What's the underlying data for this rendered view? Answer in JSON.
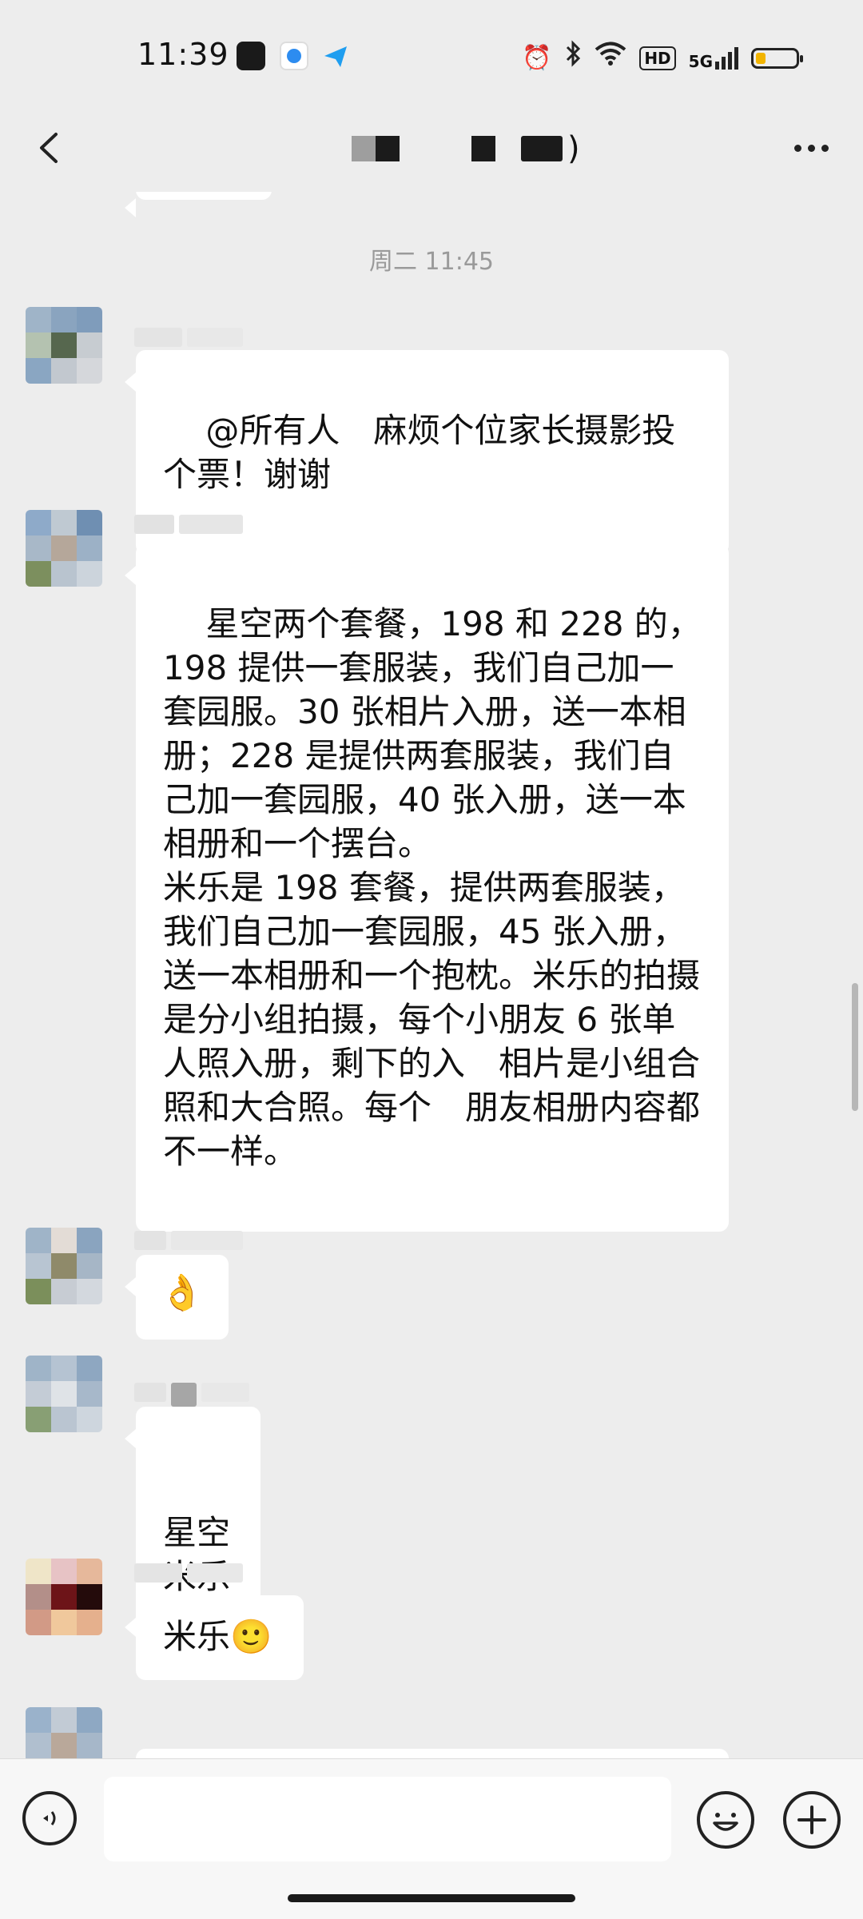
{
  "status_bar": {
    "time": "11:39",
    "network": "5G",
    "hd_label": "HD",
    "battery_percent": 25,
    "battery_color": "#f2b400",
    "icons": [
      "alarm-icon",
      "bluetooth-icon",
      "wifi-icon",
      "signal-icon"
    ]
  },
  "header": {
    "title_suffix": ")",
    "back_icon": "chevron-left-icon",
    "more_icon": "more-dots-icon"
  },
  "chat": {
    "timestamp": "周二 11:45",
    "messages": [
      {
        "text": "@所有人　麻烦个位家长摄影投个票！谢谢"
      },
      {
        "text": "星空两个套餐，198 和 228 的，198 提供一套服装，我们自己加一套园服。30 张相片入册，送一本相册；228 是提供两套服装，我们自己加一套园服，40 张入册，送一本相册和一个摆台。\n米乐是 198 套餐，提供两套服装，我们自己加一套园服，45 张入册，送一本相册和一个抱枕。米乐的拍摄是分小组拍摄，每个小朋友 6 张单人照入册，剩下的入　相片是小组合照和大合照。每个　朋友相册内容都不一样。"
      },
      {
        "text": "👌"
      },
      {
        "text": "星空\n米乐"
      },
      {
        "text": "米乐🙂"
      }
    ]
  },
  "input": {
    "placeholder": ""
  }
}
